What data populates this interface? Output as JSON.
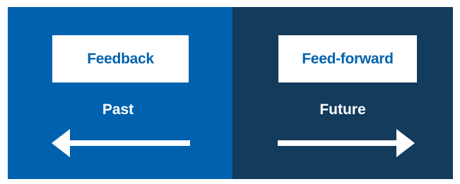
{
  "colors": {
    "left_panel": "#0062AE",
    "right_panel": "#133B5C",
    "label_box": "#FFFFFF",
    "label_text": "#0062AE",
    "time_text": "#FFFFFF",
    "arrow": "#FFFFFF"
  },
  "left": {
    "label": "Feedback",
    "time": "Past",
    "arrow_direction": "left",
    "arrow_icon": "arrow-left-icon"
  },
  "right": {
    "label": "Feed-forward",
    "time": "Future",
    "arrow_direction": "right",
    "arrow_icon": "arrow-right-icon"
  }
}
